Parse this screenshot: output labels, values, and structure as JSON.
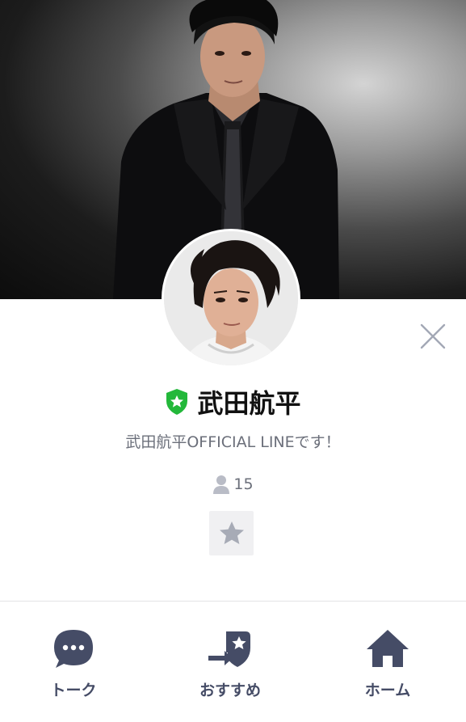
{
  "profile": {
    "name": "武田航平",
    "status_message": "武田航平OFFICIAL LINEです！",
    "friend_count": "15",
    "official_badge_icon": "shield-star-icon",
    "badge_color": "#23b83a"
  },
  "actions": {
    "close_icon": "close-icon",
    "favorite_icon": "star-icon"
  },
  "bottom_nav": {
    "items": [
      {
        "label": "トーク",
        "icon": "chat-bubble-icon"
      },
      {
        "label": "おすすめ",
        "icon": "recommend-shield-icon"
      },
      {
        "label": "ホーム",
        "icon": "home-icon"
      }
    ],
    "color": "#454c66"
  }
}
